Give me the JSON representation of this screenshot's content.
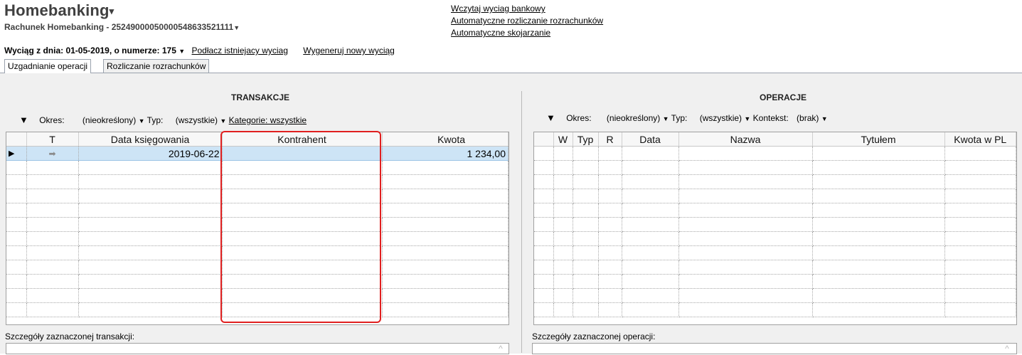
{
  "header": {
    "title": "Homebanking",
    "title_caret": "▾",
    "account": "Rachunek Homebanking - 25249000050000548633521111",
    "account_caret": "▼"
  },
  "links": {
    "import_statement": "Wczytaj wyciag bankowy",
    "auto_settle": "Automatyczne rozliczanie rozrachunków",
    "auto_match": "Automatyczne skojarzanie"
  },
  "statement": {
    "label": "Wyciąg z dnia: 01-05-2019, o numerze: 175",
    "caret": "▼",
    "attach_existing": "Podłacz istniejacy wyciag",
    "generate_new": "Wygeneruj nowy wyciąg"
  },
  "tabs": [
    {
      "label": "Uzgadnianie operacji",
      "active": true
    },
    {
      "label": "Rozliczanie rozrachunków",
      "active": false
    }
  ],
  "transactions": {
    "title": "TRANSAKCJE",
    "expand": "▼",
    "period_label": "Okres:",
    "period_value": "(nieokreślony)",
    "type_label": "Typ:",
    "type_value": "(wszystkie)",
    "category": "Kategorie: wszystkie",
    "columns": [
      "",
      "T",
      "Data księgowania",
      "Kontrahent",
      "Kwota"
    ],
    "rows": [
      {
        "marker": "▶",
        "type_icon": "➡",
        "date": "2019-06-22",
        "counterparty": "",
        "amount": "1 234,00"
      }
    ],
    "details_label": "Szczegóły zaznaczonej transakcji:"
  },
  "operations": {
    "title": "OPERACJE",
    "expand": "▼",
    "period_label": "Okres:",
    "period_value": "(nieokreślony)",
    "type_label": "Typ:",
    "type_value": "(wszystkie)",
    "context_label": "Kontekst:",
    "context_value": "(brak)",
    "columns": [
      "",
      "W",
      "Typ",
      "R",
      "Data",
      "Nazwa",
      "Tytułem",
      "Kwota w PL"
    ],
    "details_label": "Szczegóły zaznaczonej operacji:"
  },
  "colors": {
    "selected_row": "#cde4f6",
    "highlight_box": "#e02020"
  }
}
